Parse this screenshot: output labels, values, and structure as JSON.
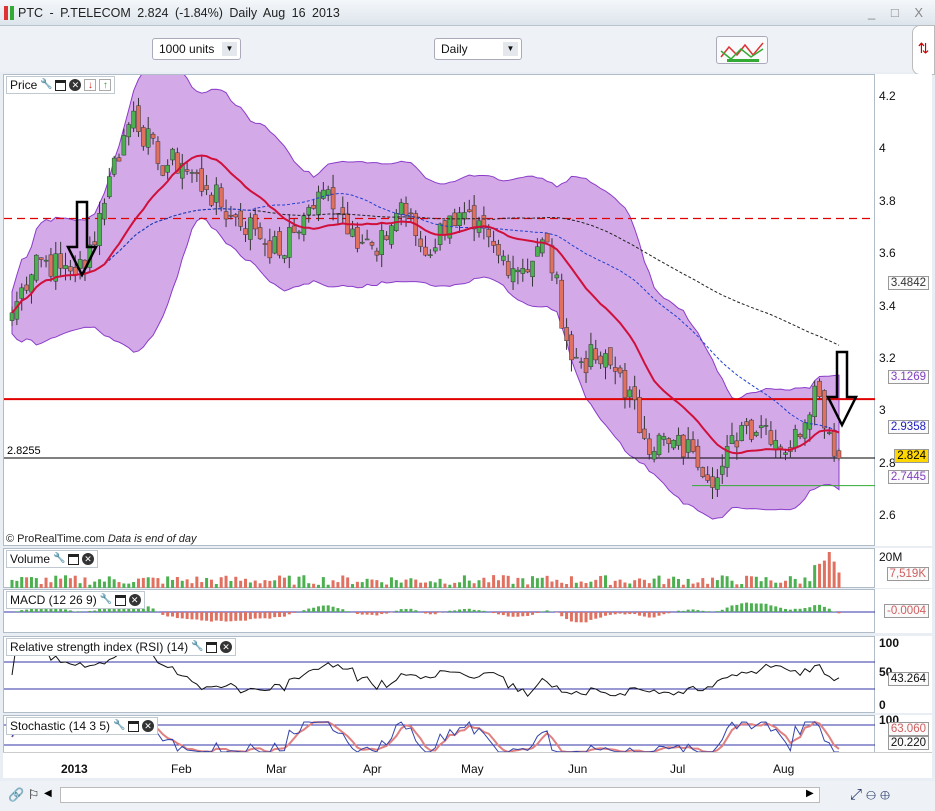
{
  "window": {
    "title": "PTC - P.TELECOM   2.824 (-1.84%)   Daily  Aug 16 2013",
    "controls": "_ □ X"
  },
  "toolbar": {
    "units": "1000 units",
    "period": "Daily"
  },
  "price_panel": {
    "title": "Price",
    "credit": "© ProRealTime.com",
    "credit_note": "Data is end of day",
    "ref_level_label": "2.8255",
    "axis_ticks": [
      "4.2",
      "4",
      "3.8",
      "3.6",
      "3.4",
      "3.2",
      "3",
      "2.8",
      "2.6"
    ],
    "value_labels": [
      {
        "text": "3.4842",
        "color": "#333333"
      },
      {
        "text": "3.1269",
        "color": "#8040c0"
      },
      {
        "text": "2.9358",
        "color": "#2020c0"
      },
      {
        "text": "2.824",
        "color": "#000000",
        "bg": "#ffd700"
      },
      {
        "text": "2.7445",
        "color": "#8040c0"
      }
    ],
    "colors": {
      "band": "#d4a9e8",
      "band_edge": "#8a3cc8",
      "ma_fast": "#d0103a",
      "ma_mid": "#2040d0",
      "ma_slow": "#222222",
      "up": "#4caf50",
      "down": "#e07060",
      "resistance": "#e00000"
    }
  },
  "volume_panel": {
    "title": "Volume",
    "axis_tick": "20M",
    "value": "7,519K"
  },
  "macd_panel": {
    "title": "MACD (12 26 9)",
    "value": "-0.0004"
  },
  "rsi_panel": {
    "title": "Relative strength index (RSI) (14)",
    "ticks": [
      "100",
      "50",
      "0"
    ],
    "value": "43.264"
  },
  "stoch_panel": {
    "title": "Stochastic (14 3 5)",
    "tick": "100",
    "value_k": "63.060",
    "value_d": "20.220"
  },
  "x_axis": {
    "labels": [
      "2013",
      "Feb",
      "Mar",
      "Apr",
      "May",
      "Jun",
      "Jul",
      "Aug"
    ]
  },
  "chart_data": {
    "type": "candlestick",
    "title": "PTC - P.TELECOM",
    "period": "Daily",
    "ylim": [
      2.55,
      4.25
    ],
    "weekly_close_approx": [
      3.38,
      3.6,
      3.55,
      3.55,
      3.9,
      4.15,
      3.95,
      3.95,
      3.85,
      3.75,
      3.7,
      3.6,
      3.75,
      3.85,
      3.7,
      3.6,
      3.8,
      3.6,
      3.75,
      3.7,
      3.6,
      3.55,
      3.65,
      3.2,
      3.2,
      3.15,
      2.9,
      2.88,
      2.85,
      2.75,
      2.95,
      2.95,
      2.85,
      3.1,
      2.824
    ],
    "last_close": 2.824,
    "change_pct": -1.84,
    "horizontal_lines": [
      3.74,
      3.05,
      2.8255,
      2.72
    ]
  }
}
